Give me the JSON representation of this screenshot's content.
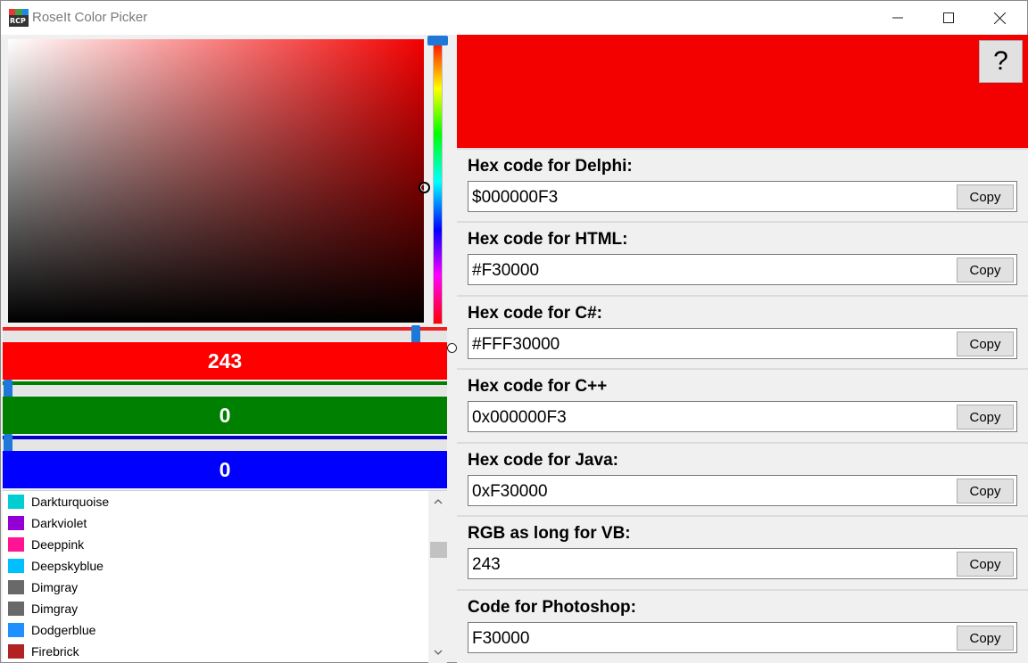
{
  "window": {
    "title": "RoseIt Color Picker"
  },
  "icons": {
    "app": "rcp-logo-icon",
    "minimize": "minimize-icon",
    "maximize": "maximize-icon",
    "close": "close-icon",
    "scroll_up": "chevron-up-icon",
    "scroll_down": "chevron-down-icon"
  },
  "picker": {
    "hue": 0,
    "saturation": 1.0,
    "brightness": 0.95,
    "red": {
      "value": "243",
      "color": "#ff0000",
      "track_color": "#ee2222",
      "level": 0.953
    },
    "green": {
      "value": "0",
      "color": "#008000",
      "track_color": "#008000",
      "level": 0
    },
    "blue": {
      "value": "0",
      "color": "#0000ff",
      "track_color": "#0000cc",
      "level": 0
    }
  },
  "color_list": {
    "items": [
      {
        "label": "Darkturquoise",
        "color": "#00ced1"
      },
      {
        "label": "Darkviolet",
        "color": "#9400d3"
      },
      {
        "label": "Deeppink",
        "color": "#ff1493"
      },
      {
        "label": "Deepskyblue",
        "color": "#00bfff"
      },
      {
        "label": "Dimgray",
        "color": "#696969"
      },
      {
        "label": "Dimgray",
        "color": "#696969"
      },
      {
        "label": "Dodgerblue",
        "color": "#1e90ff"
      },
      {
        "label": "Firebrick",
        "color": "#b22222"
      }
    ]
  },
  "preview": {
    "color": "#f30000",
    "help_label": "?"
  },
  "codes": [
    {
      "label": "Hex code for Delphi:",
      "value": "$000000F3",
      "copy_label": "Copy"
    },
    {
      "label": "Hex code for HTML:",
      "value": "#F30000",
      "copy_label": "Copy"
    },
    {
      "label": "Hex code for C#:",
      "value": "#FFF30000",
      "copy_label": "Copy"
    },
    {
      "label": "Hex code for C++",
      "value": "0x000000F3",
      "copy_label": "Copy"
    },
    {
      "label": "Hex code for Java:",
      "value": "0xF30000",
      "copy_label": "Copy"
    },
    {
      "label": "RGB as long for VB:",
      "value": "243",
      "copy_label": "Copy"
    },
    {
      "label": "Code for Photoshop:",
      "value": "F30000",
      "copy_label": "Copy"
    }
  ]
}
